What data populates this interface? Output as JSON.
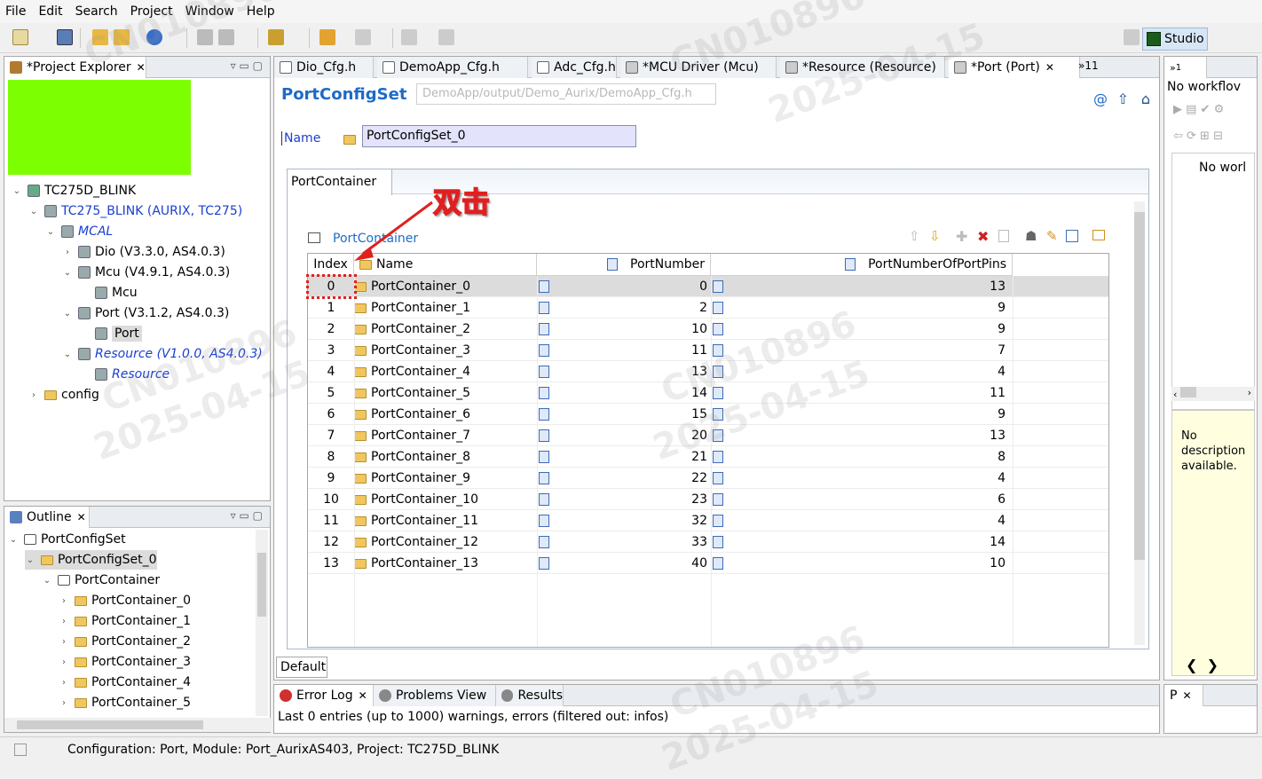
{
  "menu": [
    "File",
    "Edit",
    "Search",
    "Project",
    "Window",
    "Help"
  ],
  "studio_label": "Studio",
  "project_explorer": {
    "title": "*Project Explorer",
    "tree": [
      {
        "label": "TC275D_BLINK",
        "indent": 0,
        "twisty": "v",
        "style": ""
      },
      {
        "label": "TC275_BLINK (AURIX, TC275)",
        "indent": 1,
        "twisty": "v",
        "style": "blue"
      },
      {
        "label": "MCAL",
        "indent": 2,
        "twisty": "v",
        "style": "blue ital"
      },
      {
        "label": "Dio (V3.3.0, AS4.0.3)",
        "indent": 3,
        "twisty": ">",
        "style": ""
      },
      {
        "label": "Mcu (V4.9.1, AS4.0.3)",
        "indent": 3,
        "twisty": "v",
        "style": ""
      },
      {
        "label": "Mcu",
        "indent": 4,
        "twisty": "",
        "style": ""
      },
      {
        "label": "Port (V3.1.2, AS4.0.3)",
        "indent": 3,
        "twisty": "v",
        "style": ""
      },
      {
        "label": "Port",
        "indent": 4,
        "twisty": "",
        "style": "sel"
      },
      {
        "label": "Resource (V1.0.0, AS4.0.3)",
        "indent": 3,
        "twisty": "v",
        "style": "blue ital"
      },
      {
        "label": "Resource",
        "indent": 4,
        "twisty": "",
        "style": "blue ital"
      },
      {
        "label": "config",
        "indent": 1,
        "twisty": ">",
        "style": "folder"
      }
    ]
  },
  "outline": {
    "title": "Outline",
    "tree": [
      {
        "label": "PortConfigSet",
        "indent": 0,
        "twisty": "v"
      },
      {
        "label": "PortConfigSet_0",
        "indent": 1,
        "twisty": "v"
      },
      {
        "label": "PortContainer",
        "indent": 2,
        "twisty": "v"
      },
      {
        "label": "PortContainer_0",
        "indent": 3,
        "twisty": ">"
      },
      {
        "label": "PortContainer_1",
        "indent": 3,
        "twisty": ">"
      },
      {
        "label": "PortContainer_2",
        "indent": 3,
        "twisty": ">"
      },
      {
        "label": "PortContainer_3",
        "indent": 3,
        "twisty": ">"
      },
      {
        "label": "PortContainer_4",
        "indent": 3,
        "twisty": ">"
      },
      {
        "label": "PortContainer_5",
        "indent": 3,
        "twisty": ">"
      }
    ]
  },
  "editor_tabs": [
    "Dio_Cfg.h",
    "DemoApp_Cfg.h",
    "Adc_Cfg.h",
    "*MCU Driver (Mcu)",
    "*Resource (Resource)",
    "*Port (Port)"
  ],
  "editor_overflow": "»11",
  "editor": {
    "title": "PortConfigSet",
    "path": "DemoApp/output/Demo_Aurix/DemoApp_Cfg.h",
    "name_label": "Name",
    "name_value": "PortConfigSet_0",
    "container_tab": "PortContainer",
    "table_title": "PortContainer",
    "columns": [
      "Index",
      "Name",
      "PortNumber",
      "PortNumberOfPortPins"
    ],
    "rows": [
      [
        "0",
        "PortContainer_0",
        "0",
        "13"
      ],
      [
        "1",
        "PortContainer_1",
        "2",
        "9"
      ],
      [
        "2",
        "PortContainer_2",
        "10",
        "9"
      ],
      [
        "3",
        "PortContainer_3",
        "11",
        "7"
      ],
      [
        "4",
        "PortContainer_4",
        "13",
        "4"
      ],
      [
        "5",
        "PortContainer_5",
        "14",
        "11"
      ],
      [
        "6",
        "PortContainer_6",
        "15",
        "9"
      ],
      [
        "7",
        "PortContainer_7",
        "20",
        "13"
      ],
      [
        "8",
        "PortContainer_8",
        "21",
        "8"
      ],
      [
        "9",
        "PortContainer_9",
        "22",
        "4"
      ],
      [
        "10",
        "PortContainer_10",
        "23",
        "6"
      ],
      [
        "11",
        "PortContainer_11",
        "32",
        "4"
      ],
      [
        "12",
        "PortContainer_12",
        "33",
        "14"
      ],
      [
        "13",
        "PortContainer_13",
        "40",
        "10"
      ]
    ],
    "bottom_tab": "Default",
    "annotation": "双击"
  },
  "right_panel": {
    "tab": "1",
    "workflow": "No workflov",
    "no_work": "No worl",
    "desc": "No description available.",
    "p_tab": "P"
  },
  "bottom": {
    "tabs": [
      "Error Log",
      "Problems View",
      "Results"
    ],
    "message": "Last 0 entries (up to 1000) warnings, errors (filtered out: infos)"
  },
  "status": "Configuration: Port, Module: Port_AurixAS403, Project: TC275D_BLINK",
  "watermark": [
    "CN010896",
    "2025-04-15"
  ]
}
